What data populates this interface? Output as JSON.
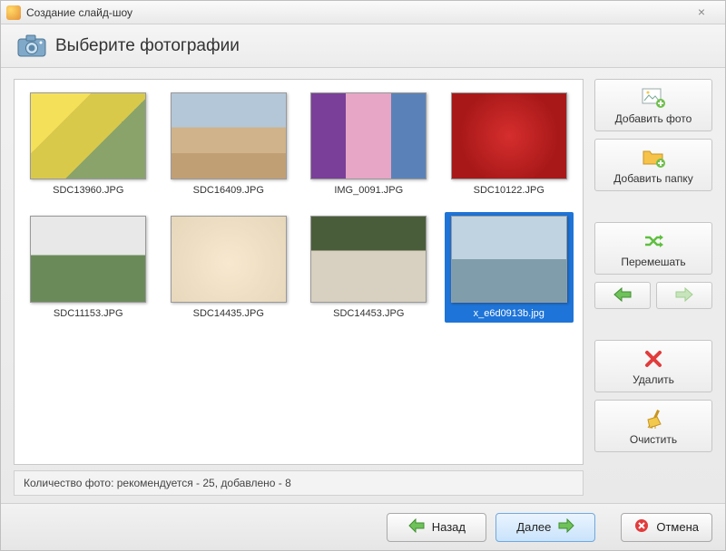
{
  "window": {
    "title": "Создание слайд-шоу"
  },
  "header": {
    "title": "Выберите фотографии"
  },
  "photos": [
    {
      "label": "SDC13960.JPG",
      "selected": false
    },
    {
      "label": "SDC16409.JPG",
      "selected": false
    },
    {
      "label": "IMG_0091.JPG",
      "selected": false
    },
    {
      "label": "SDC10122.JPG",
      "selected": false
    },
    {
      "label": "SDC11153.JPG",
      "selected": false
    },
    {
      "label": "SDC14435.JPG",
      "selected": false
    },
    {
      "label": "SDC14453.JPG",
      "selected": false
    },
    {
      "label": "x_e6d0913b.jpg",
      "selected": true
    }
  ],
  "status": {
    "text": "Количество фото: рекомендуется - 25, добавлено - 8"
  },
  "sidebar": {
    "add_photo": "Добавить фото",
    "add_folder": "Добавить папку",
    "shuffle": "Перемешать",
    "delete": "Удалить",
    "clear": "Очистить"
  },
  "footer": {
    "back": "Назад",
    "next": "Далее",
    "cancel": "Отмена"
  }
}
